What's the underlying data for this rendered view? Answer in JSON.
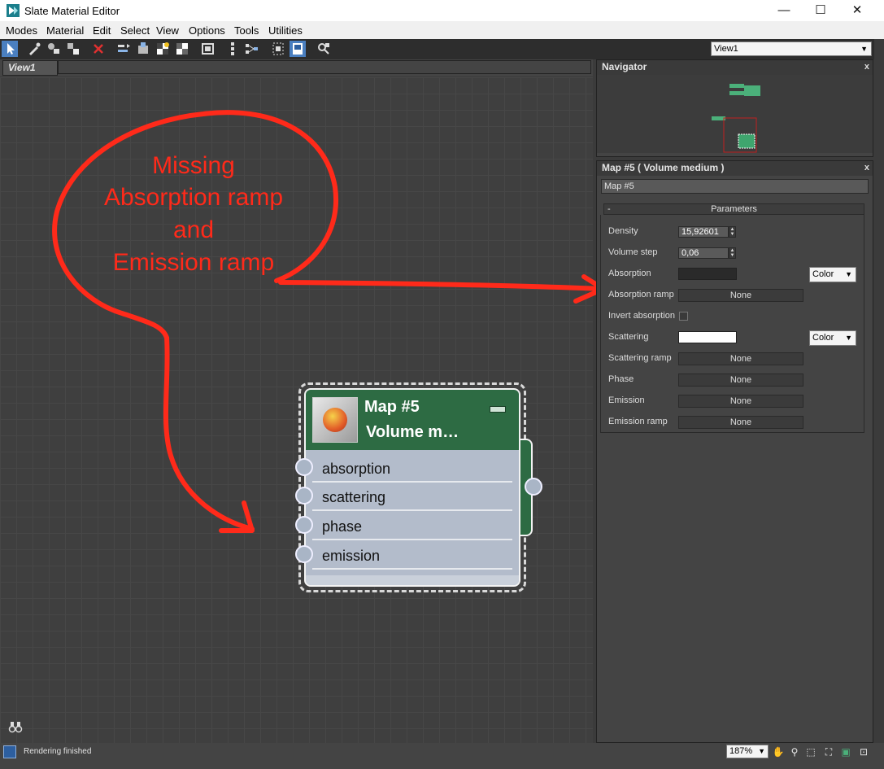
{
  "window": {
    "title": "Slate Material Editor",
    "minimize": "—",
    "maximize": "☐",
    "close": "✕"
  },
  "menu": [
    "Modes",
    "Material",
    "Edit",
    "Select",
    "View",
    "Options",
    "Tools",
    "Utilities"
  ],
  "view_select": {
    "value": "View1"
  },
  "view_tab": {
    "label": "View1"
  },
  "annotation": {
    "lines": [
      "Missing",
      "Absorption ramp",
      "and",
      "Emission ramp"
    ],
    "color": "#ff2a1a"
  },
  "node": {
    "title": "Map #5",
    "subtitle": "Volume  m…",
    "slots": [
      "absorption",
      "scattering",
      "phase",
      "emission"
    ],
    "header_color": "#2d6b43",
    "body_color": "#b3bccb"
  },
  "navigator": {
    "title": "Navigator",
    "close": "x"
  },
  "properties": {
    "title": "Map #5  ( Volume medium )",
    "close": "x",
    "map_name": "Map #5",
    "rollout": {
      "label": "Parameters",
      "collapse": "-"
    },
    "density": {
      "label": "Density",
      "value": "15,92601"
    },
    "volume_step": {
      "label": "Volume step",
      "value": "0,06"
    },
    "absorption": {
      "label": "Absorption",
      "swatch_color": "#2a2a2a",
      "mode": "Color"
    },
    "absorption_ramp": {
      "label": "Absorption ramp",
      "value": "None"
    },
    "invert_absorption": {
      "label": "Invert absorption",
      "checked": false
    },
    "scattering": {
      "label": "Scattering",
      "swatch_color": "#ffffff",
      "mode": "Color"
    },
    "scattering_ramp": {
      "label": "Scattering ramp",
      "value": "None"
    },
    "phase": {
      "label": "Phase",
      "value": "None"
    },
    "emission": {
      "label": "Emission",
      "value": "None"
    },
    "emission_ramp": {
      "label": "Emission ramp",
      "value": "None"
    }
  },
  "status": {
    "text": "Rendering finished",
    "zoom": "187%"
  }
}
